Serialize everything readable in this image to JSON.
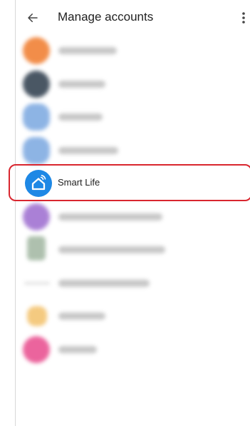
{
  "header": {
    "title": "Manage accounts"
  },
  "accounts": [
    {
      "label": "",
      "blurred": true,
      "color": "#f07a2a"
    },
    {
      "label": "",
      "blurred": true,
      "color": "#2b3a4a"
    },
    {
      "label": "",
      "blurred": true,
      "color": "#7aa7e0"
    },
    {
      "label": "",
      "blurred": true,
      "color": "#7aa7e0"
    },
    {
      "label": "Smart Life",
      "blurred": false,
      "color": "#1e88e5",
      "highlighted": true
    },
    {
      "label": "",
      "blurred": true,
      "color": "#9c6bcf"
    },
    {
      "label": "",
      "blurred": true,
      "color": "#a0b6a0"
    },
    {
      "label": "",
      "blurred": true,
      "color": "#bcbcbc"
    },
    {
      "label": "",
      "blurred": true,
      "color": "#f3c16a"
    },
    {
      "label": "",
      "blurred": true,
      "color": "#e84a8c"
    }
  ],
  "highlight_color": "#d9262f"
}
